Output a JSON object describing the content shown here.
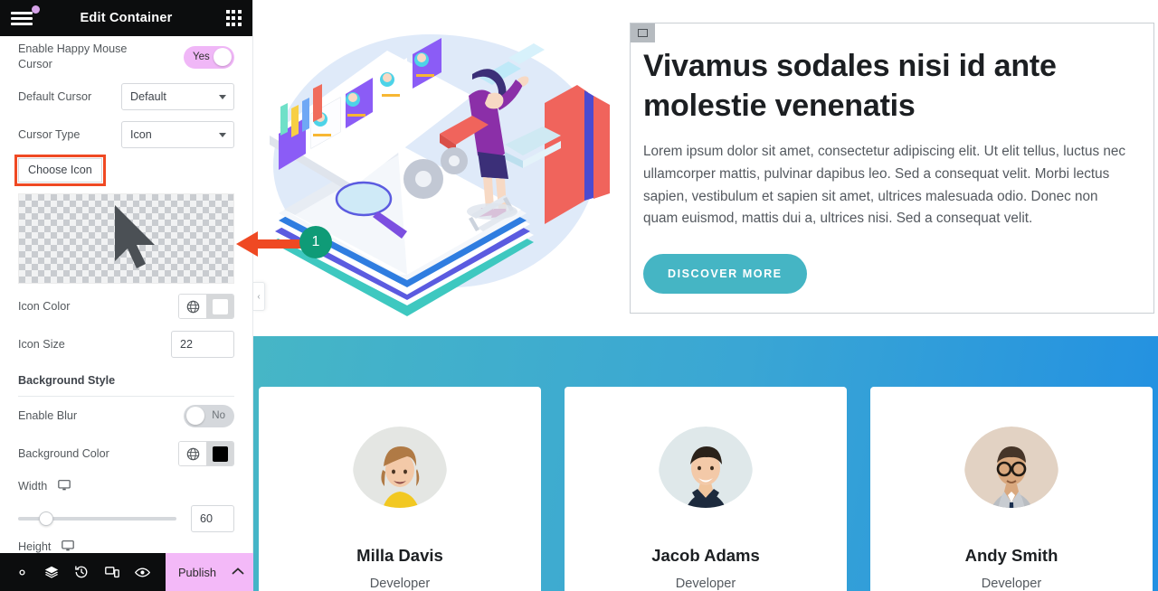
{
  "panel": {
    "title": "Edit Container",
    "menu_icon": "hamburger-icon",
    "apps_icon": "grid-apps-icon",
    "controls": {
      "enable_happy_mouse_cursor": {
        "label": "Enable Happy Mouse Cursor",
        "value": "Yes",
        "state": "on"
      },
      "default_cursor": {
        "label": "Default Cursor",
        "value": "Default"
      },
      "cursor_type": {
        "label": "Cursor Type",
        "value": "Icon"
      },
      "choose_icon": {
        "label": "Choose Icon",
        "highlight_color": "#ef4923"
      },
      "icon_preview": {
        "name": "mouse-pointer-icon",
        "color": "#4b5055"
      },
      "icon_color": {
        "label": "Icon Color",
        "swatch": "#ffffff"
      },
      "icon_size": {
        "label": "Icon Size",
        "value": "22"
      },
      "background_style_heading": "Background Style",
      "enable_blur": {
        "label": "Enable Blur",
        "value": "No",
        "state": "off"
      },
      "background_color": {
        "label": "Background Color",
        "swatch": "#000000"
      },
      "width": {
        "label": "Width",
        "value": "60",
        "slider_percent": 13
      },
      "height": {
        "label": "Height"
      }
    },
    "footer": {
      "icons": [
        "settings-gear-icon",
        "layers-navigator-icon",
        "history-revisions-icon",
        "responsive-mode-icon",
        "preview-eye-icon"
      ],
      "publish_label": "Publish",
      "publish_bg": "#f3b9f8",
      "expand_icon": "chevron-up-icon"
    },
    "collapse_handle": "‹"
  },
  "canvas": {
    "hero": {
      "illustration_alt": "isometric-recruitment-illustration",
      "element_handle_icon": "container-handle-icon",
      "title": "Vivamus sodales nisi id ante molestie venenatis",
      "paragraph": "Lorem ipsum dolor sit amet, consectetur adipiscing elit. Ut elit tellus, luctus nec ullamcorper mattis, pulvinar dapibus leo. Sed a consequat velit. Morbi lectus sapien, vestibulum et sapien sit amet, ultrices malesuada odio. Donec non quam euismod, mattis dui a, ultrices nisi. Sed a consequat velit.",
      "button_label": "DISCOVER MORE",
      "button_color": "#45b5c4"
    },
    "team": {
      "gradient_from": "#46b6c6",
      "gradient_to": "#2290e2",
      "members": [
        {
          "name": "Milla Davis",
          "role": "Developer",
          "avatar": "woman-yellow-top-avatar"
        },
        {
          "name": "Jacob Adams",
          "role": "Developer",
          "avatar": "man-navy-shirt-avatar"
        },
        {
          "name": "Andy Smith",
          "role": "Developer",
          "avatar": "man-glasses-suit-avatar"
        }
      ]
    }
  },
  "annotation": {
    "step_number": "1",
    "arrow_color": "#ef4923",
    "badge_color": "#0f9b77"
  }
}
